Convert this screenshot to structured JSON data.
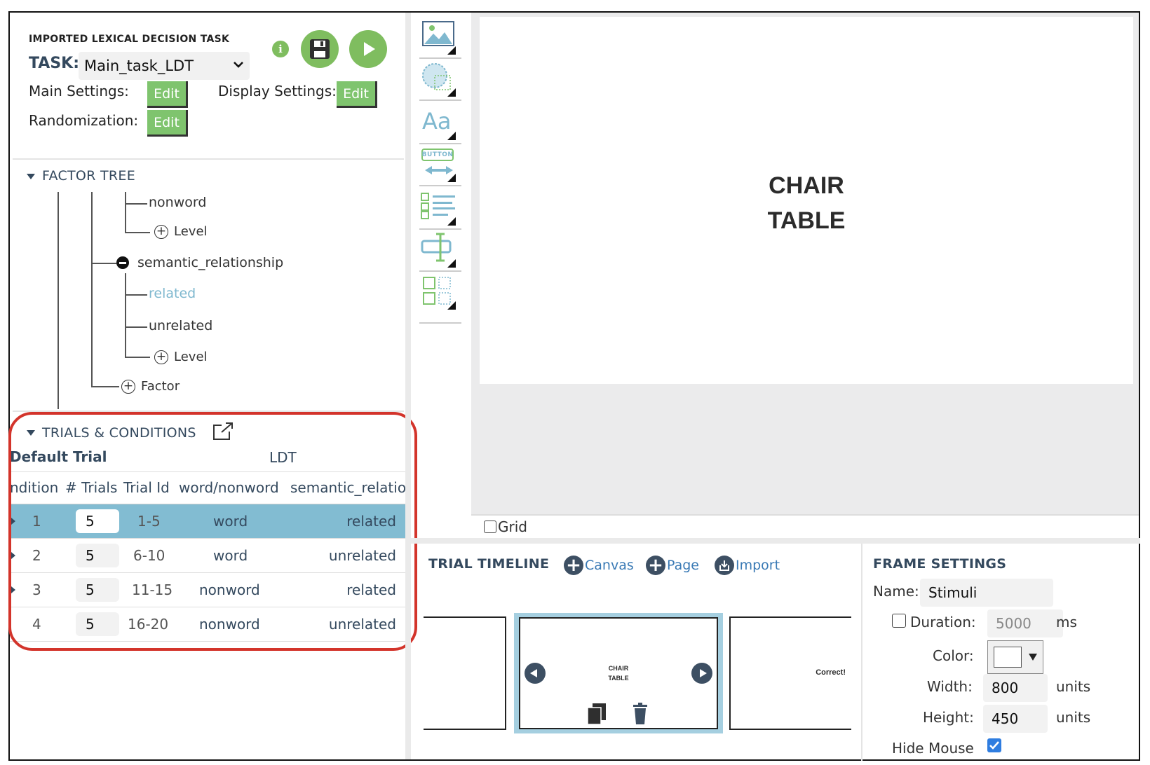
{
  "header": {
    "project_title": "IMPORTED LEXICAL DECISION TASK",
    "task_label": "TASK:",
    "task_selected": "Main_task_LDT",
    "main_settings_label": "Main Settings:",
    "display_settings_label": "Display Settings:",
    "randomization_label": "Randomization:",
    "edit_label": "Edit",
    "info_icon": "info-icon",
    "save_icon": "save-icon",
    "play_icon": "play-icon"
  },
  "factor_tree": {
    "title": "FACTOR TREE",
    "items": {
      "nonword": "nonword",
      "level_add_1": "Level",
      "semantic_relationship": "semantic_relationship",
      "related": "related",
      "unrelated": "unrelated",
      "level_add_2": "Level",
      "factor_add": "Factor"
    }
  },
  "trials": {
    "title": "TRIALS & CONDITIONS",
    "default_trial": "Default Trial",
    "group_label": "LDT",
    "columns": [
      "ndition",
      "# Trials",
      "Trial Id",
      "word/nonword",
      "semantic_relatio"
    ],
    "rows": [
      {
        "condition": "1",
        "num_trials": "5",
        "trial_id": "1-5",
        "word_nonword": "word",
        "semantic": "related",
        "selected": true
      },
      {
        "condition": "2",
        "num_trials": "5",
        "trial_id": "6-10",
        "word_nonword": "word",
        "semantic": "unrelated",
        "selected": false
      },
      {
        "condition": "3",
        "num_trials": "5",
        "trial_id": "11-15",
        "word_nonword": "nonword",
        "semantic": "related",
        "selected": false
      },
      {
        "condition": "4",
        "num_trials": "5",
        "trial_id": "16-20",
        "word_nonword": "nonword",
        "semantic": "unrelated",
        "selected": false
      }
    ]
  },
  "toolbar": {
    "tools": [
      "image-tool-icon",
      "shape-tool-icon",
      "text-tool-icon",
      "button-tool-icon",
      "list-tool-icon",
      "input-tool-icon",
      "grid-tool-icon"
    ],
    "button_tool_text": "BUTTON",
    "text_tool_text": "Aa"
  },
  "canvas": {
    "line1": "CHAIR",
    "line2": "TABLE",
    "grid_label": "Grid",
    "grid_checked": false
  },
  "timeline": {
    "title": "TRIAL TIMELINE",
    "canvas_label": "Canvas",
    "page_label": "Page",
    "import_label": "Import",
    "thumb_center_line1": "CHAIR",
    "thumb_center_line2": "TABLE",
    "thumb_right_text": "Correct!"
  },
  "frame_settings": {
    "title": "FRAME SETTINGS",
    "name_label": "Name:",
    "name_value": "Stimuli",
    "duration_label": "Duration:",
    "duration_value": "5000",
    "duration_unit": "ms",
    "duration_checked": false,
    "color_label": "Color:",
    "color_value": "#ffffff",
    "width_label": "Width:",
    "width_value": "800",
    "height_label": "Height:",
    "height_value": "450",
    "units_label": "units",
    "hide_mouse_label": "Hide Mouse",
    "hide_mouse_checked": true
  },
  "colors": {
    "accent_green": "#7fc46e",
    "selected_row": "#82bcd2",
    "highlight_red": "#d3342b",
    "dark_slate": "#34495e"
  }
}
